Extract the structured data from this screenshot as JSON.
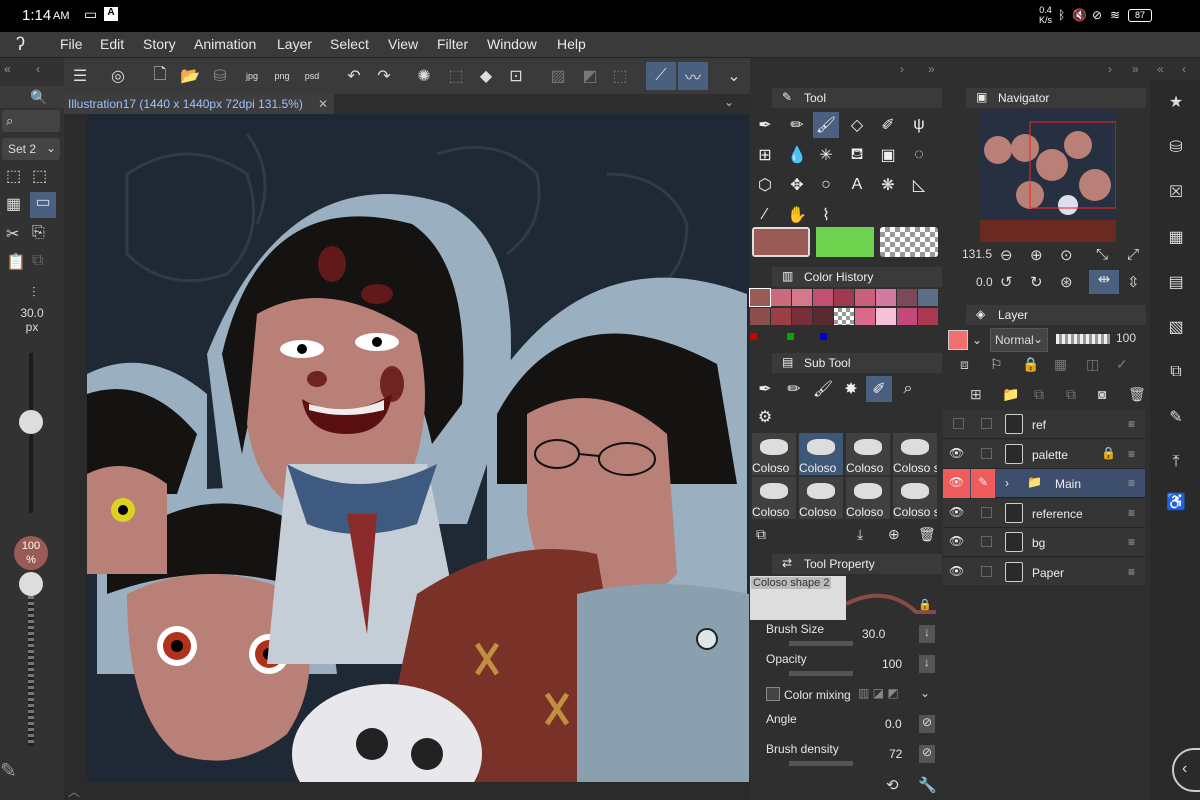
{
  "status": {
    "time": "1:14",
    "ampm": "AM",
    "speed_top": "0.4",
    "speed_bottom": "K/s",
    "battery": "87"
  },
  "menu": [
    "File",
    "Edit",
    "Story",
    "Animation",
    "Layer",
    "Select",
    "View",
    "Filter",
    "Window",
    "Help"
  ],
  "toolbar": {
    "jpg": "jpg",
    "png": "png",
    "psd": "psd"
  },
  "document": {
    "tab_title": "Illustration17 (1440 x 1440px 72dpi 131.5%)",
    "close": "✕"
  },
  "leftpanel": {
    "set": "Set 2",
    "brush_size": "30.0",
    "brush_unit": "px",
    "opacity": "100",
    "opacity_unit": "%"
  },
  "tool_panel": {
    "title": "Tool",
    "main_color": "#9a5a55",
    "sub_color": "#6fd24e"
  },
  "color_history": {
    "title": "Color History",
    "colors": [
      "#9a5a55",
      "#c96b7e",
      "#d8768a",
      "#c25070",
      "#a0384e",
      "#c8607a",
      "#d27aa0",
      "#7a4a5a",
      "#5b6e86",
      "#8c4f4e",
      "#9a3f48",
      "#7a2e3a",
      "#5a2a30",
      "checker",
      "#d96a8a",
      "#f5c0d8",
      "#c24a7a",
      "#aa3a52"
    ]
  },
  "sub_tool": {
    "title": "Sub Tool",
    "brushes": [
      "Coloso",
      "Coloso",
      "Coloso",
      "Coloso s",
      "Coloso",
      "Coloso",
      "Coloso",
      "Coloso s"
    ]
  },
  "tool_property": {
    "title": "Tool Property",
    "brush_name": "Coloso shape 2",
    "brush_size_label": "Brush Size",
    "brush_size": "30.0",
    "opacity_label": "Opacity",
    "opacity": "100",
    "color_mixing": "Color mixing",
    "angle_label": "Angle",
    "angle": "0.0",
    "density_label": "Brush density",
    "density": "72"
  },
  "navigator": {
    "title": "Navigator",
    "zoom": "131.5",
    "rotation": "0.0"
  },
  "layer": {
    "title": "Layer",
    "blend": "Normal",
    "opacity": "100",
    "color": "#f07070",
    "rows": [
      {
        "name": "ref"
      },
      {
        "name": "palette"
      },
      {
        "name": "Main"
      },
      {
        "name": "reference"
      },
      {
        "name": "bg"
      },
      {
        "name": "Paper"
      }
    ]
  }
}
